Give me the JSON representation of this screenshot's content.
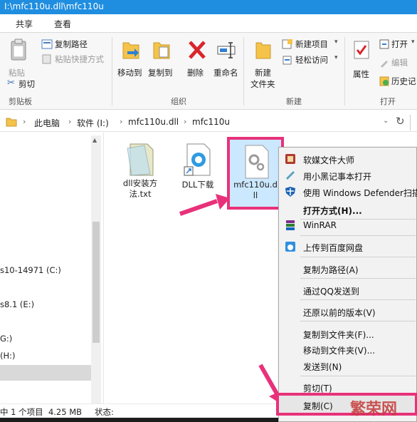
{
  "window": {
    "title": "I:\\mfc110u.dll\\mfc110u"
  },
  "ribbon_tabs": [
    "共享",
    "查看"
  ],
  "ribbon": {
    "clipboard": {
      "paste": "粘贴",
      "copy_path": "复制路径",
      "paste_shortcut": "粘贴快捷方式",
      "cut": "剪切",
      "group_label": "剪贴板"
    },
    "organize": {
      "move_to": "移动到",
      "copy_to": "复制到",
      "delete": "删除",
      "rename": "重命名",
      "group_label": "组织"
    },
    "new": {
      "new_folder_line1": "新建",
      "new_folder_line2": "文件夹",
      "new_item": "新建项目",
      "easy_access": "轻松访问",
      "group_label": "新建"
    },
    "open": {
      "properties": "属性",
      "open": "打开",
      "edit": "编辑",
      "history": "历史记",
      "group_label": "打开"
    }
  },
  "address": {
    "crumbs": [
      "此电脑",
      "软件 (I:)",
      "mfc110u.dll",
      "mfc110u"
    ]
  },
  "nav": {
    "items": [
      "s10-14971 (C:)",
      "s8.1 (E:)",
      "G:)",
      " (H:)"
    ]
  },
  "files": [
    {
      "name": "dll安装方\n法.txt",
      "icon": "text-file-icon"
    },
    {
      "name": "DLL下载",
      "icon": "shortcut-icon"
    },
    {
      "name": "mfc110u.d\nll",
      "icon": "dll-file-icon"
    }
  ],
  "status": {
    "selection": "中 1 个项目  4.25 MB",
    "state_label": "状态:"
  },
  "context_menu": {
    "items": [
      {
        "label": "软媒文件大师",
        "icon": "ruanmei-icon"
      },
      {
        "label": "用小黑记事本打开",
        "icon": "notepad-icon"
      },
      {
        "label": "使用 Windows Defender扫描",
        "icon": "defender-shield-icon"
      },
      {
        "label": "打开方式(H)...",
        "icon": ""
      },
      {
        "label": "WinRAR",
        "icon": "winrar-icon"
      },
      {
        "label": "上传到百度网盘",
        "icon": "baidu-cloud-icon"
      },
      {
        "label": "复制为路径(A)",
        "icon": ""
      },
      {
        "label": "通过QQ发送到",
        "icon": ""
      },
      {
        "label": "还原以前的版本(V)",
        "icon": ""
      },
      {
        "label": "复制到文件夹(F)...",
        "icon": ""
      },
      {
        "label": "移动到文件夹(V)...",
        "icon": ""
      },
      {
        "label": "发送到(N)",
        "icon": ""
      },
      {
        "label": "剪切(T)",
        "icon": ""
      },
      {
        "label": "复制(C)",
        "icon": ""
      }
    ]
  },
  "watermark": "繁荣网",
  "colors": {
    "accent": "#1f8ee0",
    "annotation": "#e8317a"
  }
}
